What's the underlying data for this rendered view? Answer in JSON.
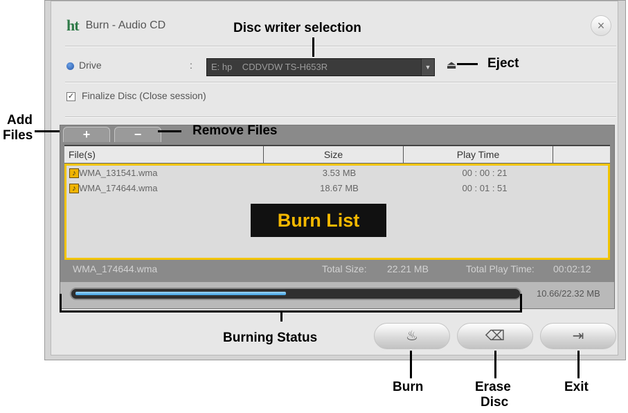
{
  "window": {
    "logo": "ht",
    "title": "Burn - Audio CD",
    "close_glyph": "×"
  },
  "drive": {
    "label": "Drive",
    "separator": ":",
    "selected": "E: hp    CDDVDW TS-H653R",
    "dropdown_glyph": "▼",
    "eject_glyph": "⏏"
  },
  "finalize": {
    "label": "Finalize Disc (Close session)",
    "checked": true
  },
  "tabs": {
    "add_glyph": "+",
    "remove_glyph": "−"
  },
  "list": {
    "columns": [
      "File(s)",
      "Size",
      "Play Time"
    ],
    "rows": [
      {
        "name": "WMA_131541.wma",
        "size": "3.53 MB",
        "time": "00 : 00 : 21"
      },
      {
        "name": "WMA_174644.wma",
        "size": "18.67 MB",
        "time": "00 : 01 : 51"
      }
    ]
  },
  "summary": {
    "current_file": "WMA_174644.wma",
    "total_size_label": "Total Size:",
    "total_size": "22.21 MB",
    "total_time_label": "Total Play Time:",
    "total_time": "00:02:12"
  },
  "progress": {
    "fraction": 0.478,
    "text": "10.66/22.32 MB"
  },
  "buttons": {
    "burn": "Burn",
    "erase": "Erase Disc",
    "exit": "Exit"
  },
  "annotations": {
    "disc_writer": "Disc writer selection",
    "eject": "Eject",
    "add_files_1": "Add",
    "add_files_2": "Files",
    "remove_files": "Remove Files",
    "burn_list": "Burn List",
    "burning_status": "Burning Status",
    "burn": "Burn",
    "erase_1": "Erase",
    "erase_2": "Disc",
    "exit": "Exit"
  },
  "colors": {
    "highlight": "#f2c400",
    "progress": "#3e9fe0",
    "logo": "#2f7a48"
  }
}
